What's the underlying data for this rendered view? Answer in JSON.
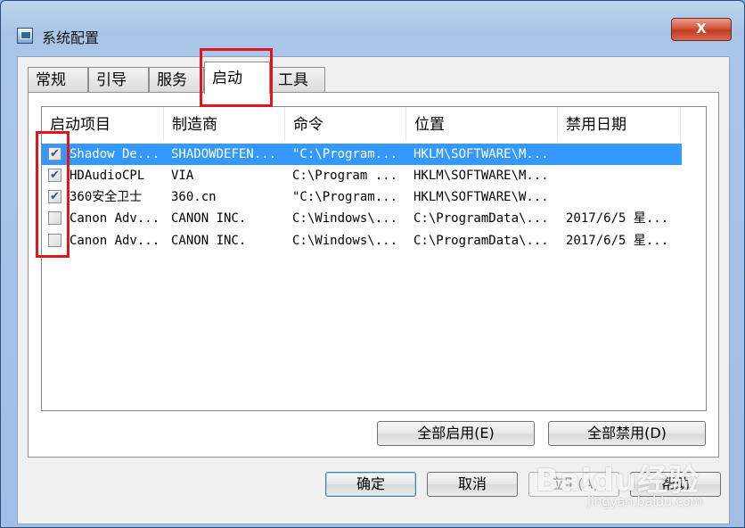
{
  "window": {
    "title": "系统配置",
    "close_label": "X"
  },
  "tabs": [
    {
      "label": "常规"
    },
    {
      "label": "引导"
    },
    {
      "label": "服务"
    },
    {
      "label": "启动"
    },
    {
      "label": "工具"
    }
  ],
  "list": {
    "columns": [
      "启动项目",
      "制造商",
      "命令",
      "位置",
      "禁用日期"
    ],
    "rows": [
      {
        "checked": true,
        "name": "Shadow De...",
        "maker": "SHADOWDEFEN...",
        "command": "\"C:\\Program...",
        "location": "HKLM\\SOFTWARE\\M...",
        "date": ""
      },
      {
        "checked": true,
        "name": "HDAudioCPL",
        "maker": "VIA",
        "command": "C:\\Program ...",
        "location": "HKLM\\SOFTWARE\\M...",
        "date": ""
      },
      {
        "checked": true,
        "name": "360安全卫士",
        "maker": "360.cn",
        "command": "\"C:\\Program...",
        "location": "HKLM\\SOFTWARE\\W...",
        "date": ""
      },
      {
        "checked": false,
        "name": "Canon Adv...",
        "maker": "CANON INC.",
        "command": "C:\\Windows\\...",
        "location": "C:\\ProgramData\\...",
        "date": "2017/6/5 星..."
      },
      {
        "checked": false,
        "name": "Canon Adv...",
        "maker": "CANON INC.",
        "command": "C:\\Windows\\...",
        "location": "C:\\ProgramData\\...",
        "date": "2017/6/5 星..."
      }
    ]
  },
  "buttons": {
    "enable_all": "全部启用(E)",
    "disable_all": "全部禁用(D)",
    "ok": "确定",
    "cancel": "取消",
    "apply": "应用(A)",
    "help": "帮助"
  },
  "watermark": {
    "main": "Baidu经验",
    "sub": "jingyan.baidu.com"
  },
  "colors": {
    "selection": "#3399ff",
    "annotation": "#e3151c",
    "close": "#c23a22"
  }
}
